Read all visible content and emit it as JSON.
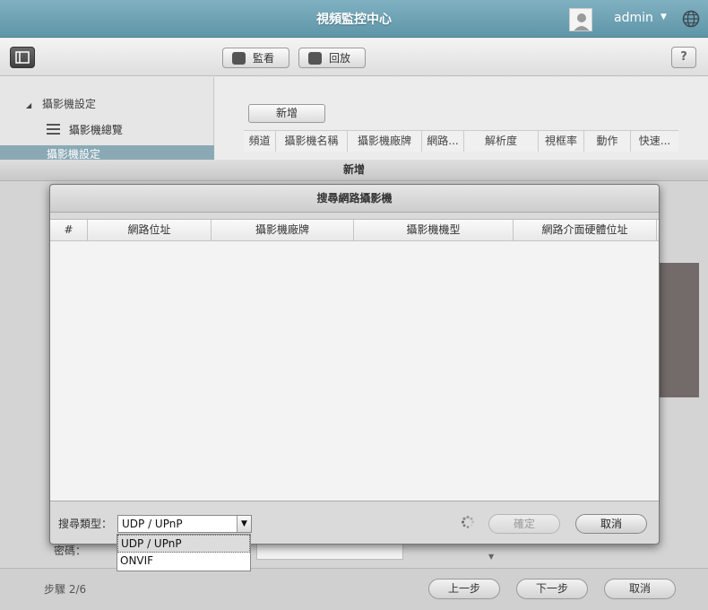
{
  "app": {
    "title": "視頻監控中心",
    "username": "admin"
  },
  "toolbar": {
    "monitor_label": "監看",
    "playback_label": "回放",
    "help_label": "?"
  },
  "sidebar": {
    "group_label": "攝影機設定",
    "items": [
      {
        "label": "攝影機總覽"
      },
      {
        "label": "攝影機設定"
      }
    ]
  },
  "main": {
    "add_label": "新增",
    "columns": [
      "頻道",
      "攝影機名稱",
      "攝影機廠牌",
      "網路...",
      "解析度",
      "視框率",
      "動作",
      "快速..."
    ]
  },
  "wizard": {
    "title": "新增",
    "password_label": "密碼：",
    "step_label": "步驟 2/6",
    "prev_label": "上一步",
    "next_label": "下一步",
    "cancel_label": "取消"
  },
  "search_dialog": {
    "title": "搜尋網路攝影機",
    "columns": [
      "#",
      "網路位址",
      "攝影機廠牌",
      "攝影機機型",
      "網路介面硬體位址"
    ],
    "search_type_label": "搜尋類型：",
    "selected_type": "UDP / UPnP",
    "options": [
      "UDP / UPnP",
      "ONVIF"
    ],
    "ok_label": "確定",
    "cancel_label": "取消"
  }
}
